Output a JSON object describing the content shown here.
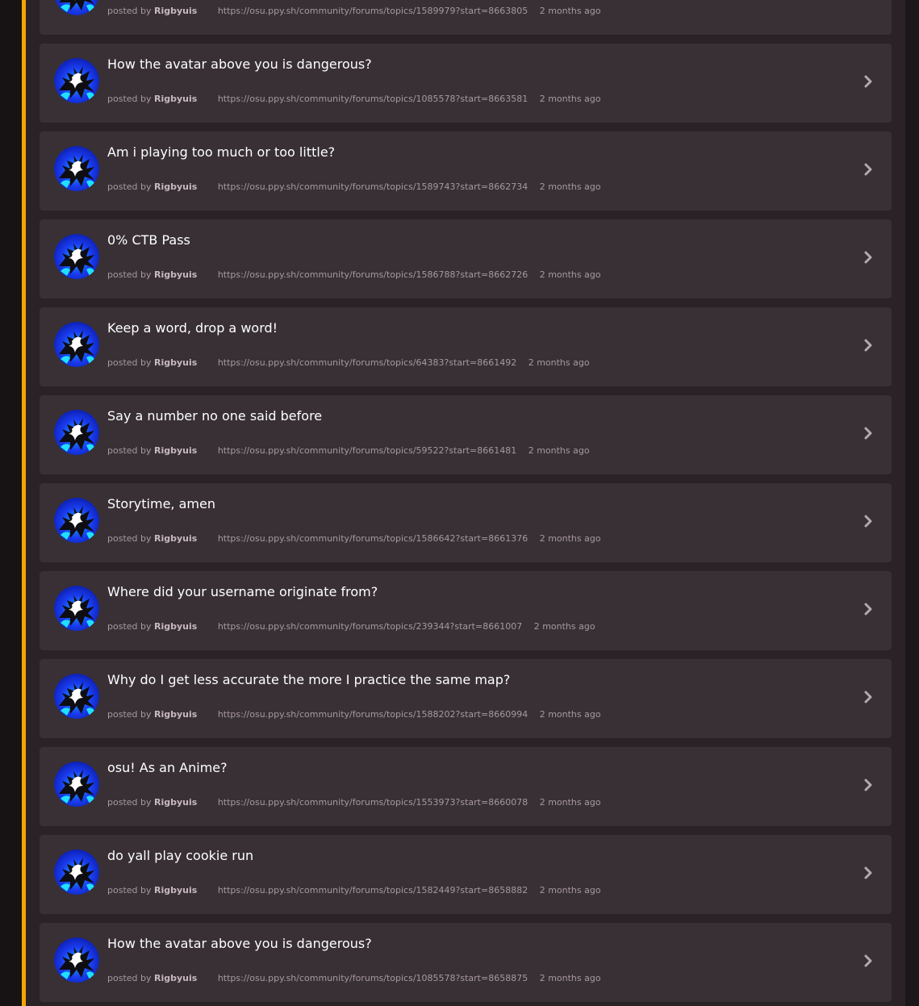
{
  "posts": [
    {
      "title": "",
      "posted_by": "posted by",
      "author": "Rigbyuis",
      "url": "https://osu.ppy.sh/community/forums/topics/1589979?start=8663805",
      "time": "2 months ago"
    },
    {
      "title": "How the avatar above you is dangerous?",
      "posted_by": "posted by",
      "author": "Rigbyuis",
      "url": "https://osu.ppy.sh/community/forums/topics/1085578?start=8663581",
      "time": "2 months ago"
    },
    {
      "title": "Am i playing too much or too little?",
      "posted_by": "posted by",
      "author": "Rigbyuis",
      "url": "https://osu.ppy.sh/community/forums/topics/1589743?start=8662734",
      "time": "2 months ago"
    },
    {
      "title": "0% CTB Pass",
      "posted_by": "posted by",
      "author": "Rigbyuis",
      "url": "https://osu.ppy.sh/community/forums/topics/1586788?start=8662726",
      "time": "2 months ago"
    },
    {
      "title": "Keep a word, drop a word!",
      "posted_by": "posted by",
      "author": "Rigbyuis",
      "url": "https://osu.ppy.sh/community/forums/topics/64383?start=8661492",
      "time": "2 months ago"
    },
    {
      "title": "Say a number no one said before",
      "posted_by": "posted by",
      "author": "Rigbyuis",
      "url": "https://osu.ppy.sh/community/forums/topics/59522?start=8661481",
      "time": "2 months ago"
    },
    {
      "title": "Storytime, amen",
      "posted_by": "posted by",
      "author": "Rigbyuis",
      "url": "https://osu.ppy.sh/community/forums/topics/1586642?start=8661376",
      "time": "2 months ago"
    },
    {
      "title": "Where did your username originate from?",
      "posted_by": "posted by",
      "author": "Rigbyuis",
      "url": "https://osu.ppy.sh/community/forums/topics/239344?start=8661007",
      "time": "2 months ago"
    },
    {
      "title": "Why do I get less accurate the more I practice the same map?",
      "posted_by": "posted by",
      "author": "Rigbyuis",
      "url": "https://osu.ppy.sh/community/forums/topics/1588202?start=8660994",
      "time": "2 months ago"
    },
    {
      "title": "osu! As an Anime?",
      "posted_by": "posted by",
      "author": "Rigbyuis",
      "url": "https://osu.ppy.sh/community/forums/topics/1553973?start=8660078",
      "time": "2 months ago"
    },
    {
      "title": "do yall play cookie run",
      "posted_by": "posted by",
      "author": "Rigbyuis",
      "url": "https://osu.ppy.sh/community/forums/topics/1582449?start=8658882",
      "time": "2 months ago"
    },
    {
      "title": "How the avatar above you is dangerous?",
      "posted_by": "posted by",
      "author": "Rigbyuis",
      "url": "https://osu.ppy.sh/community/forums/topics/1085578?start=8658875",
      "time": "2 months ago"
    }
  ],
  "colors": {
    "accent": "#f4a500",
    "card_bg": "#383035",
    "page_bg": "#2a2226"
  },
  "icons": {
    "avatar": "user-avatar-image",
    "chevron": "chevron-right-icon"
  }
}
